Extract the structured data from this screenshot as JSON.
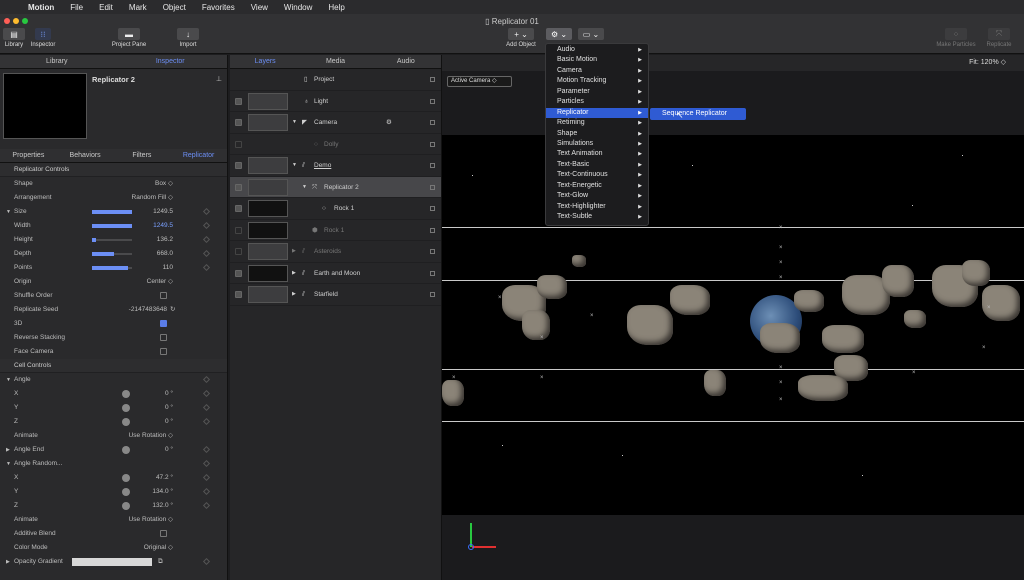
{
  "menubar": {
    "app": "Motion",
    "items": [
      "File",
      "Edit",
      "Mark",
      "Object",
      "Favorites",
      "View",
      "Window",
      "Help"
    ]
  },
  "window": {
    "title": "Replicator 01"
  },
  "toolbar": {
    "library": "Library",
    "inspector": "Inspector",
    "project_pane": "Project Pane",
    "import": "Import",
    "add_object": "Add Object",
    "make_particles": "Make Particles",
    "replicate": "Replicate"
  },
  "left_tabs": [
    "Library",
    "Inspector"
  ],
  "preview_title": "Replicator 2",
  "inspector_tabs": [
    "Properties",
    "Behaviors",
    "Filters",
    "Replicator"
  ],
  "replicator_controls": {
    "header": "Replicator Controls",
    "shape": {
      "label": "Shape",
      "value": "Box ◇"
    },
    "arrangement": {
      "label": "Arrangement",
      "value": "Random Fill ◇"
    },
    "size": {
      "label": "Size",
      "value": "1249.5"
    },
    "width": {
      "label": "Width",
      "value": "1249.5"
    },
    "height": {
      "label": "Height",
      "value": "136.2"
    },
    "depth": {
      "label": "Depth",
      "value": "668.0"
    },
    "points": {
      "label": "Points",
      "value": "110"
    },
    "origin": {
      "label": "Origin",
      "value": "Center ◇"
    },
    "shuffle": {
      "label": "Shuffle Order"
    },
    "seed": {
      "label": "Replicate Seed",
      "value": "-2147483648"
    },
    "three_d": {
      "label": "3D"
    },
    "reverse": {
      "label": "Reverse Stacking"
    },
    "face": {
      "label": "Face Camera"
    }
  },
  "cell_controls": {
    "header": "Cell Controls",
    "angle": "Angle",
    "ax": {
      "label": "X",
      "value": "0 °"
    },
    "ay": {
      "label": "Y",
      "value": "0 °"
    },
    "az": {
      "label": "Z",
      "value": "0 °"
    },
    "animate1": {
      "label": "Animate",
      "value": "Use Rotation ◇"
    },
    "angle_end": {
      "label": "Angle End",
      "value": "0 °"
    },
    "angle_random": "Angle Random...",
    "rx": {
      "label": "X",
      "value": "47.2 °"
    },
    "ry": {
      "label": "Y",
      "value": "134.0 °"
    },
    "rz": {
      "label": "Z",
      "value": "132.0 °"
    },
    "animate2": {
      "label": "Animate",
      "value": "Use Rotation ◇"
    },
    "additive": {
      "label": "Additive Blend"
    },
    "color_mode": {
      "label": "Color Mode",
      "value": "Original ◇"
    },
    "opacity": {
      "label": "Opacity Gradient"
    }
  },
  "layer_tabs": [
    "Layers",
    "Media",
    "Audio"
  ],
  "layers": [
    "Project",
    "Light",
    "Camera",
    "Dolly",
    "Demo",
    "Replicator 2",
    "Rock 1",
    "Rock 1",
    "Asteroids",
    "Earth and Moon",
    "Starfield"
  ],
  "canvas": {
    "camera": "Active Camera ◇",
    "fit": "Fit: 120% ◇"
  },
  "add_menu": [
    "Audio",
    "Basic Motion",
    "Camera",
    "Motion Tracking",
    "Parameter",
    "Particles",
    "Replicator",
    "Retiming",
    "Shape",
    "Simulations",
    "Text Animation",
    "Text-Basic",
    "Text-Continuous",
    "Text-Energetic",
    "Text-Glow",
    "Text-Highlighter",
    "Text-Subtle"
  ],
  "submenu_item": "Sequence Replicator"
}
